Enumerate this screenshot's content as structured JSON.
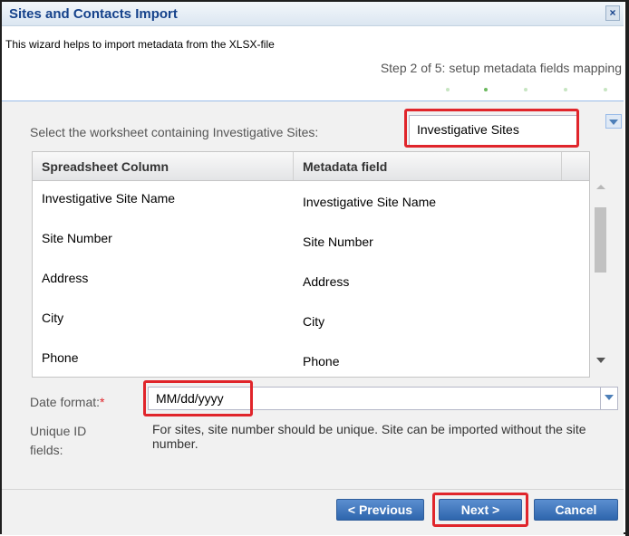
{
  "dialog": {
    "title": "Sites and Contacts Import",
    "description": "This wizard helps to import metadata from the XLSX-file",
    "step_text": "Step 2 of 5: setup metadata fields mapping",
    "step_total": 5,
    "step_current": 2
  },
  "worksheet": {
    "label": "Select the worksheet containing Investigative Sites:",
    "value": "Investigative Sites",
    "clear_glyph": "×"
  },
  "grid": {
    "columns": [
      "Spreadsheet Column",
      "Metadata field"
    ],
    "rows": [
      {
        "column": "Investigative Site Name",
        "field": "Investigative Site Name"
      },
      {
        "column": "Site Number",
        "field": "Site Number"
      },
      {
        "column": "Address",
        "field": "Address"
      },
      {
        "column": "City",
        "field": "City"
      },
      {
        "column": "Phone",
        "field": "Phone"
      }
    ]
  },
  "date_format": {
    "label": "Date format:",
    "required_mark": "*",
    "value": "MM/dd/yyyy"
  },
  "unique_id": {
    "label": "Unique ID fields:",
    "text": "For sites, site number should be unique. Site can be imported without the site number."
  },
  "buttons": {
    "previous": "< Previous",
    "next": "Next >",
    "cancel": "Cancel"
  },
  "colors": {
    "title": "#15428b",
    "highlight": "#e0252b",
    "button": "#2e65ad",
    "step_dot_active": "#6cb95f",
    "step_dot": "#c7e5c2"
  }
}
